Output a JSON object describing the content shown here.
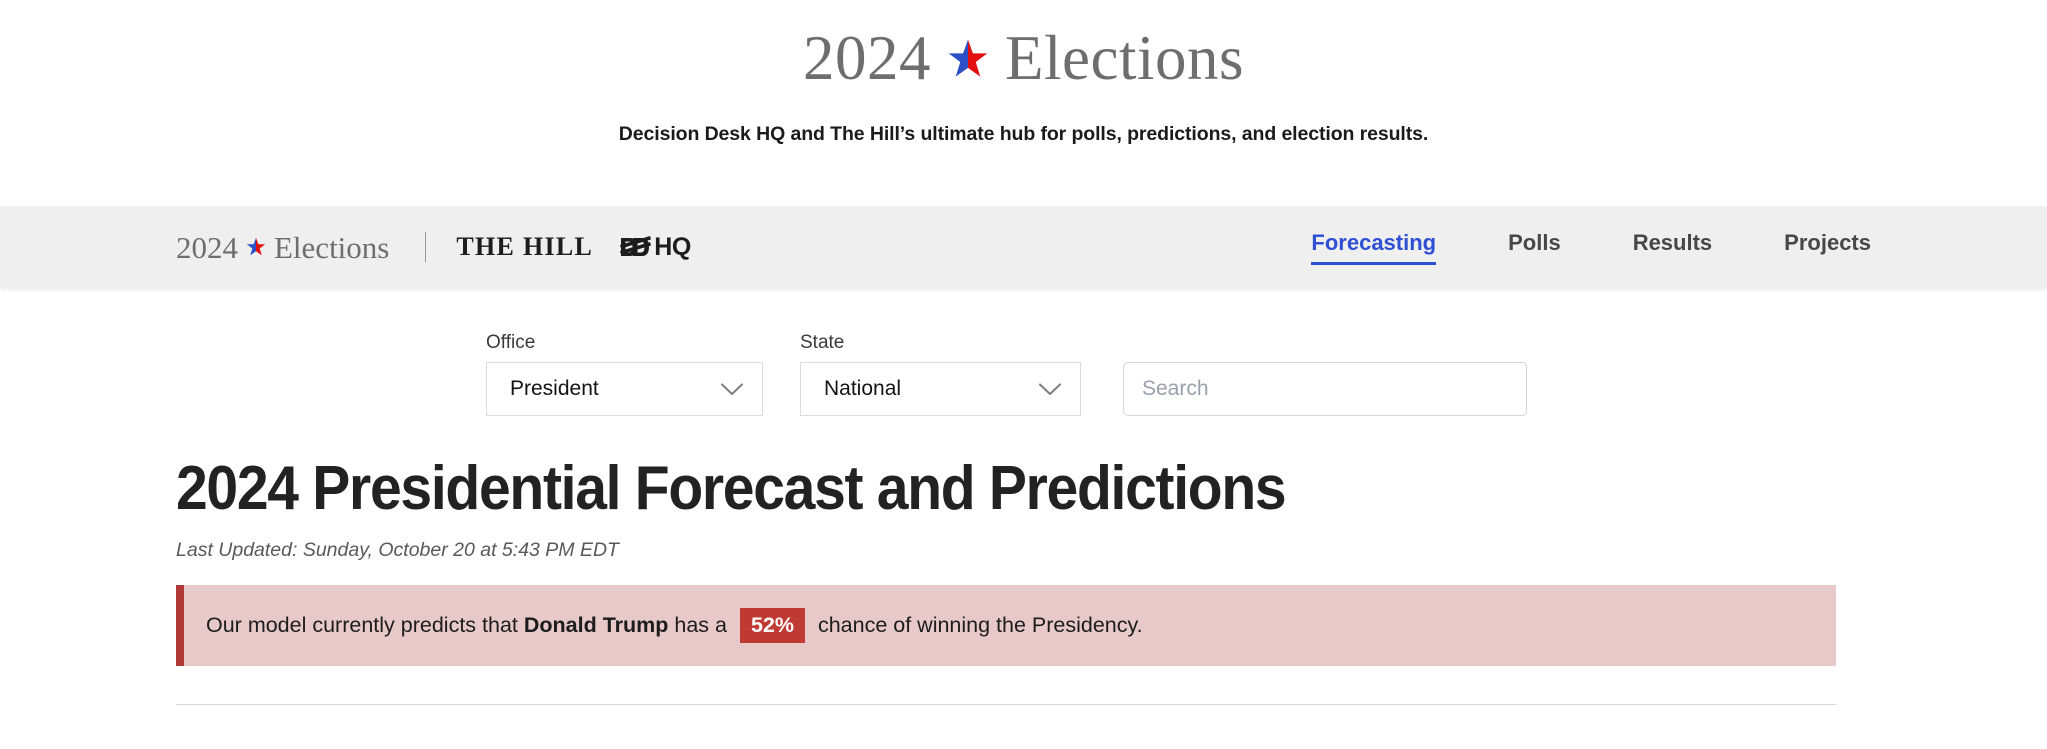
{
  "masthead": {
    "brand_year": "2024",
    "brand_rest": "Elections",
    "star_icon": "split-star-icon",
    "star_left_color": "#2b4fc4",
    "star_right_color": "#e21010",
    "tagline": "Decision Desk HQ and The Hill’s ultimate hub for polls, predictions, and election results."
  },
  "navbar": {
    "brand_year": "2024",
    "brand_rest": "Elections",
    "partner_hill": "THE HILL",
    "partner_ddhq": "HQ",
    "partner_ddhq_full": "DDHQ",
    "links": [
      {
        "label": "Forecasting",
        "active": true
      },
      {
        "label": "Polls",
        "active": false
      },
      {
        "label": "Results",
        "active": false
      },
      {
        "label": "Projects",
        "active": false
      }
    ],
    "active_color": "#2f4fd4",
    "background": "#f0efef"
  },
  "filters": {
    "office": {
      "label": "Office",
      "value": "President",
      "options": [
        "President"
      ]
    },
    "state": {
      "label": "State",
      "value": "National",
      "options": [
        "National"
      ]
    },
    "search": {
      "placeholder": "Search",
      "value": ""
    },
    "chevron_icon": "chevron-down-icon"
  },
  "main": {
    "title": "2024 Presidential Forecast and Predictions",
    "last_updated": "Last Updated: Sunday, October 20 at 5:43 PM EDT",
    "callout": {
      "lead": "Our model currently predicts that ",
      "candidate": "Donald Trump",
      "middle": " has a ",
      "percent": "52%",
      "tail": " chance of winning the Presidency.",
      "bar_color": "#b03837",
      "background": "#e8c9c9",
      "badge_color": "#bf3a33"
    }
  }
}
